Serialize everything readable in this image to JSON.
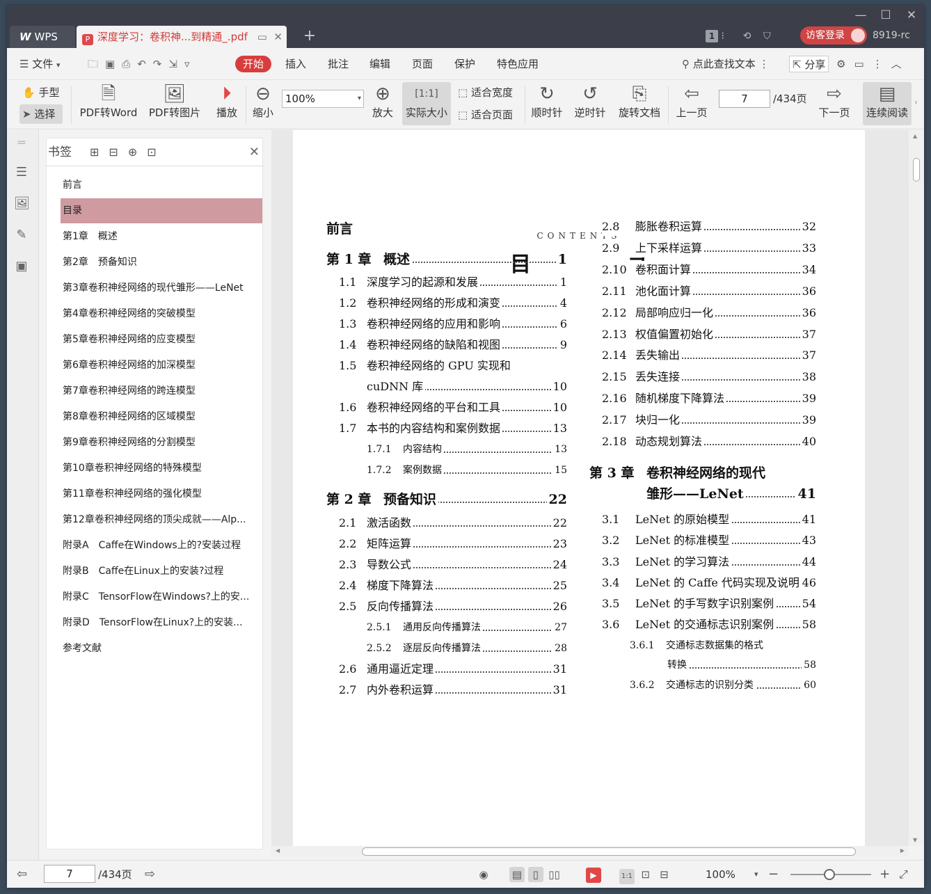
{
  "titlebar": {
    "wps_tab": "WPS",
    "doc_tab": "深度学习：卷积神...到精通_.pdf",
    "page_count_badge": "1",
    "login_button": "访客登录",
    "user_id": "8919-rc"
  },
  "menubar": {
    "file": "文件",
    "tabs": [
      "开始",
      "插入",
      "批注",
      "编辑",
      "页面",
      "保护",
      "特色应用"
    ],
    "search": "点此查找文本",
    "share": "分享"
  },
  "ribbon": {
    "hand": "手型",
    "select": "选择",
    "pdf_to_word": "PDF转Word",
    "pdf_to_image": "PDF转图片",
    "play": "播放",
    "zoom_out": "缩小",
    "zoom_value": "100%",
    "zoom_in": "放大",
    "actual_size": "实际大小",
    "fit_width": "适合宽度",
    "fit_page": "适合页面",
    "clockwise": "顺时针",
    "counterclockwise": "逆时针",
    "rotate_doc": "旋转文档",
    "prev_page": "上一页",
    "current_page": "7",
    "total_pages": "/434页",
    "next_page": "下一页",
    "continuous": "连续阅读"
  },
  "bookmarks": {
    "title": "书签",
    "items": [
      {
        "label": "前言",
        "expandable": false,
        "selected": false
      },
      {
        "label": "目录",
        "expandable": false,
        "selected": true
      },
      {
        "label": "第1章　概述",
        "expandable": true,
        "selected": false
      },
      {
        "label": "第2章　预备知识",
        "expandable": true,
        "selected": false
      },
      {
        "label": "第3章卷积神经网络的现代雏形——LeNet",
        "expandable": true,
        "selected": false
      },
      {
        "label": "第4章卷积神经网络的突破模型",
        "expandable": true,
        "selected": false
      },
      {
        "label": "第5章卷积神经网络的应变模型",
        "expandable": true,
        "selected": false
      },
      {
        "label": "第6章卷积神经网络的加深模型",
        "expandable": true,
        "selected": false
      },
      {
        "label": "第7章卷积神经网络的跨连模型",
        "expandable": true,
        "selected": false
      },
      {
        "label": "第8章卷积神经网络的区域模型",
        "expandable": true,
        "selected": false
      },
      {
        "label": "第9章卷积神经网络的分割模型",
        "expandable": true,
        "selected": false
      },
      {
        "label": "第10章卷积神经网络的特殊模型",
        "expandable": true,
        "selected": false
      },
      {
        "label": "第11章卷积神经网络的强化模型",
        "expandable": true,
        "selected": false
      },
      {
        "label": "第12章卷积神经网络的顶尖成就——Alp...",
        "expandable": true,
        "selected": false
      },
      {
        "label": "附录A　Caffe在Windows上的?安装过程",
        "expandable": false,
        "selected": false
      },
      {
        "label": "附录B　Caffe在Linux上的安装?过程",
        "expandable": false,
        "selected": false
      },
      {
        "label": "附录C　TensorFlow在Windows?上的安...",
        "expandable": false,
        "selected": false
      },
      {
        "label": "附录D　TensorFlow在Linux?上的安装...",
        "expandable": false,
        "selected": false
      },
      {
        "label": "参考文献",
        "expandable": false,
        "selected": false
      }
    ]
  },
  "document": {
    "contents_label": "CONTENTS",
    "title": "目　录",
    "left_column": [
      {
        "kind": "ch",
        "num": "",
        "text": "前言",
        "page": ""
      },
      {
        "kind": "ch",
        "num": "第 1 章",
        "text": "概述",
        "page": "1"
      },
      {
        "kind": "sec",
        "num": "1.1",
        "text": "深度学习的起源和发展",
        "page": "1"
      },
      {
        "kind": "sec",
        "num": "1.2",
        "text": "卷积神经网络的形成和演变",
        "page": "4"
      },
      {
        "kind": "sec",
        "num": "1.3",
        "text": "卷积神经网络的应用和影响",
        "page": "6"
      },
      {
        "kind": "sec",
        "num": "1.4",
        "text": "卷积神经网络的缺陷和视图",
        "page": "9"
      },
      {
        "kind": "secnp",
        "num": "1.5",
        "text": "卷积神经网络的 GPU 实现和",
        "page": ""
      },
      {
        "kind": "cont",
        "num": "",
        "text": "cuDNN 库",
        "page": "10"
      },
      {
        "kind": "sec",
        "num": "1.6",
        "text": "卷积神经网络的平台和工具",
        "page": "10"
      },
      {
        "kind": "sec",
        "num": "1.7",
        "text": "本书的内容结构和案例数据",
        "page": "13"
      },
      {
        "kind": "sub",
        "num": "1.7.1",
        "text": "内容结构",
        "page": "13"
      },
      {
        "kind": "sub",
        "num": "1.7.2",
        "text": "案例数据",
        "page": "15"
      },
      {
        "kind": "ch",
        "num": "第 2 章",
        "text": "预备知识",
        "page": "22"
      },
      {
        "kind": "sec",
        "num": "2.1",
        "text": "激活函数",
        "page": "22"
      },
      {
        "kind": "sec",
        "num": "2.2",
        "text": "矩阵运算",
        "page": "23"
      },
      {
        "kind": "sec",
        "num": "2.3",
        "text": "导数公式",
        "page": "24"
      },
      {
        "kind": "sec",
        "num": "2.4",
        "text": "梯度下降算法",
        "page": "25"
      },
      {
        "kind": "sec",
        "num": "2.5",
        "text": "反向传播算法",
        "page": "26"
      },
      {
        "kind": "sub",
        "num": "2.5.1",
        "text": "通用反向传播算法",
        "page": "27"
      },
      {
        "kind": "sub",
        "num": "2.5.2",
        "text": "逐层反向传播算法",
        "page": "28"
      },
      {
        "kind": "sec",
        "num": "2.6",
        "text": "通用逼近定理",
        "page": "31"
      },
      {
        "kind": "sec",
        "num": "2.7",
        "text": "内外卷积运算",
        "page": "31"
      }
    ],
    "right_column": [
      {
        "kind": "sec",
        "num": "2.8",
        "text": "膨胀卷积运算",
        "page": "32"
      },
      {
        "kind": "sec",
        "num": "2.9",
        "text": "上下采样运算",
        "page": "33"
      },
      {
        "kind": "sec",
        "num": "2.10",
        "text": "卷积面计算",
        "page": "34"
      },
      {
        "kind": "sec",
        "num": "2.11",
        "text": "池化面计算",
        "page": "36"
      },
      {
        "kind": "sec",
        "num": "2.12",
        "text": "局部响应归一化",
        "page": "36"
      },
      {
        "kind": "sec",
        "num": "2.13",
        "text": "权值偏置初始化",
        "page": "37"
      },
      {
        "kind": "sec",
        "num": "2.14",
        "text": "丢失输出",
        "page": "37"
      },
      {
        "kind": "sec",
        "num": "2.15",
        "text": "丢失连接",
        "page": "38"
      },
      {
        "kind": "sec",
        "num": "2.16",
        "text": "随机梯度下降算法",
        "page": "39"
      },
      {
        "kind": "sec",
        "num": "2.17",
        "text": "块归一化",
        "page": "39"
      },
      {
        "kind": "sec",
        "num": "2.18",
        "text": "动态规划算法",
        "page": "40"
      },
      {
        "kind": "chnp",
        "num": "第 3 章",
        "text": "卷积神经网络的现代",
        "page": ""
      },
      {
        "kind": "chcont",
        "num": "",
        "text": "雏形——LeNet",
        "page": "41"
      },
      {
        "kind": "sec",
        "num": "3.1",
        "text": "LeNet 的原始模型",
        "page": "41"
      },
      {
        "kind": "sec",
        "num": "3.2",
        "text": "LeNet 的标准模型",
        "page": "43"
      },
      {
        "kind": "sec",
        "num": "3.3",
        "text": "LeNet 的学习算法",
        "page": "44"
      },
      {
        "kind": "sec",
        "num": "3.4",
        "text": "LeNet 的 Caffe 代码实现及说明",
        "page": "46"
      },
      {
        "kind": "sec",
        "num": "3.5",
        "text": "LeNet 的手写数字识别案例",
        "page": "54"
      },
      {
        "kind": "sec",
        "num": "3.6",
        "text": "LeNet 的交通标志识别案例",
        "page": "58"
      },
      {
        "kind": "subnp",
        "num": "3.6.1",
        "text": "交通标志数据集的格式",
        "page": ""
      },
      {
        "kind": "subcont",
        "num": "",
        "text": "转换",
        "page": "58"
      },
      {
        "kind": "sub",
        "num": "3.6.2",
        "text": "交通标志的识别分类",
        "page": "60"
      }
    ]
  },
  "statusbar": {
    "current_page": "7",
    "total_pages": "/434页",
    "zoom": "100%"
  }
}
